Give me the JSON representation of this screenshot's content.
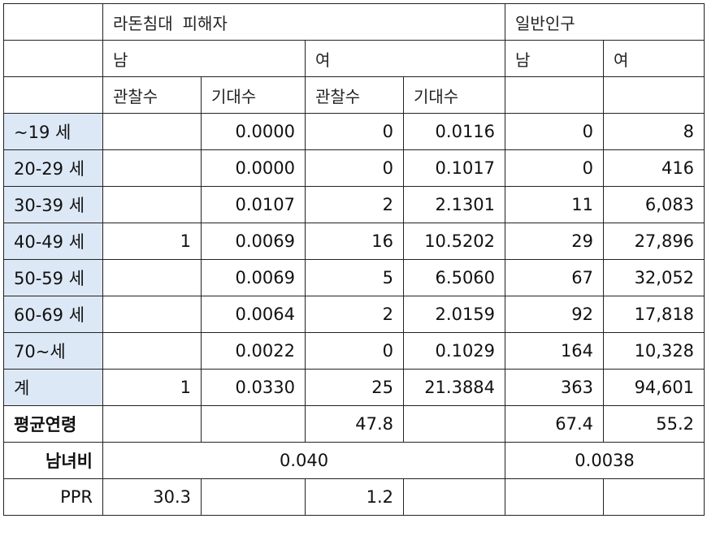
{
  "headers": {
    "group1": "라돈침대 피해자",
    "group2": "일반인구",
    "male": "남",
    "female": "여",
    "observed": "관찰수",
    "expected": "기대수"
  },
  "rows": [
    {
      "label": "~19 세",
      "m_obs": "",
      "m_exp": "0.0000",
      "f_obs": "0",
      "f_exp": "0.0116",
      "gen_m": "0",
      "gen_f": "8"
    },
    {
      "label": "20-29 세",
      "m_obs": "",
      "m_exp": "0.0000",
      "f_obs": "0",
      "f_exp": "0.1017",
      "gen_m": "0",
      "gen_f": "416"
    },
    {
      "label": "30-39 세",
      "m_obs": "",
      "m_exp": "0.0107",
      "f_obs": "2",
      "f_exp": "2.1301",
      "gen_m": "11",
      "gen_f": "6,083"
    },
    {
      "label": "40-49 세",
      "m_obs": "1",
      "m_exp": "0.0069",
      "f_obs": "16",
      "f_exp": "10.5202",
      "gen_m": "29",
      "gen_f": "27,896"
    },
    {
      "label": "50-59 세",
      "m_obs": "",
      "m_exp": "0.0069",
      "f_obs": "5",
      "f_exp": "6.5060",
      "gen_m": "67",
      "gen_f": "32,052"
    },
    {
      "label": "60-69 세",
      "m_obs": "",
      "m_exp": "0.0064",
      "f_obs": "2",
      "f_exp": "2.0159",
      "gen_m": "92",
      "gen_f": "17,818"
    },
    {
      "label": "70~세",
      "m_obs": "",
      "m_exp": "0.0022",
      "f_obs": "0",
      "f_exp": "0.1029",
      "gen_m": "164",
      "gen_f": "10,328"
    },
    {
      "label": "계",
      "m_obs": "1",
      "m_exp": "0.0330",
      "f_obs": "25",
      "f_exp": "21.3884",
      "gen_m": "363",
      "gen_f": "94,601"
    }
  ],
  "mean_age": {
    "label": "평균연령",
    "m_obs": "",
    "m_exp": "",
    "f_obs": "47.8",
    "f_exp": "",
    "gen_m": "67.4",
    "gen_f": "55.2"
  },
  "sex_ratio": {
    "label": "남녀비",
    "victims": "0.040",
    "general": "0.0038"
  },
  "ppr": {
    "label": "PPR",
    "m_obs": "30.3",
    "m_exp": "",
    "f_obs": "1.2",
    "f_exp": "",
    "gen_m": "",
    "gen_f": ""
  }
}
